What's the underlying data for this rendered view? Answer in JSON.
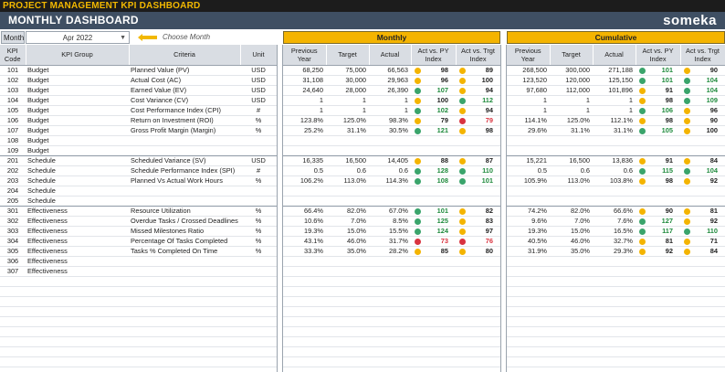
{
  "title_bar": "PROJECT MANAGEMENT KPI DASHBOARD",
  "dashboard_title": "MONTHLY DASHBOARD",
  "brand": "someka",
  "month": {
    "label": "Month",
    "value": "Apr 2022",
    "hint": "Choose Month"
  },
  "groups": {
    "monthly": "Monthly",
    "cumulative": "Cumulative"
  },
  "headers": {
    "kpi_code": "KPI Code",
    "kpi_group": "KPI Group",
    "criteria": "Criteria",
    "unit": "Unit",
    "previous_year": "Previous Year",
    "target": "Target",
    "actual": "Actual",
    "act_vs_py": "Act vs. PY Index",
    "act_vs_trgt": "Act vs. Trgt Index"
  },
  "colors": {
    "yellow": "#f4b400",
    "green": "#3aa46b",
    "red": "#d9333f",
    "header_bar": "#3f4f63"
  },
  "rows": [
    {
      "code": "101",
      "group": "Budget",
      "criteria": "Planned Value (PV)",
      "unit": "USD",
      "m": {
        "py": "68,250",
        "target": "75,000",
        "actual": "66,563",
        "pyi": {
          "dot": "yellow",
          "val": "98",
          "color": "black"
        },
        "tgi": {
          "dot": "yellow",
          "val": "89",
          "color": "black"
        }
      },
      "c": {
        "py": "268,500",
        "target": "300,000",
        "actual": "271,188",
        "pyi": {
          "dot": "green",
          "val": "101",
          "color": "green"
        },
        "tgi": {
          "dot": "yellow",
          "val": "90",
          "color": "black"
        }
      }
    },
    {
      "code": "102",
      "group": "Budget",
      "criteria": "Actual Cost (AC)",
      "unit": "USD",
      "m": {
        "py": "31,108",
        "target": "30,000",
        "actual": "29,963",
        "pyi": {
          "dot": "yellow",
          "val": "96",
          "color": "black"
        },
        "tgi": {
          "dot": "yellow",
          "val": "100",
          "color": "black"
        }
      },
      "c": {
        "py": "123,520",
        "target": "120,000",
        "actual": "125,150",
        "pyi": {
          "dot": "green",
          "val": "101",
          "color": "green"
        },
        "tgi": {
          "dot": "green",
          "val": "104",
          "color": "green"
        }
      }
    },
    {
      "code": "103",
      "group": "Budget",
      "criteria": "Earned Value (EV)",
      "unit": "USD",
      "m": {
        "py": "24,640",
        "target": "28,000",
        "actual": "26,390",
        "pyi": {
          "dot": "green",
          "val": "107",
          "color": "green"
        },
        "tgi": {
          "dot": "yellow",
          "val": "94",
          "color": "black"
        }
      },
      "c": {
        "py": "97,680",
        "target": "112,000",
        "actual": "101,896",
        "pyi": {
          "dot": "yellow",
          "val": "91",
          "color": "black"
        },
        "tgi": {
          "dot": "green",
          "val": "104",
          "color": "green"
        }
      }
    },
    {
      "code": "104",
      "group": "Budget",
      "criteria": "Cost Variance (CV)",
      "unit": "USD",
      "m": {
        "py": "1",
        "target": "1",
        "actual": "1",
        "pyi": {
          "dot": "yellow",
          "val": "100",
          "color": "black"
        },
        "tgi": {
          "dot": "green",
          "val": "112",
          "color": "green"
        }
      },
      "c": {
        "py": "1",
        "target": "1",
        "actual": "1",
        "pyi": {
          "dot": "yellow",
          "val": "98",
          "color": "black"
        },
        "tgi": {
          "dot": "green",
          "val": "109",
          "color": "green"
        }
      }
    },
    {
      "code": "105",
      "group": "Budget",
      "criteria": "Cost Performance Index (CPI)",
      "unit": "#",
      "m": {
        "py": "1",
        "target": "1",
        "actual": "1",
        "pyi": {
          "dot": "green",
          "val": "102",
          "color": "green"
        },
        "tgi": {
          "dot": "yellow",
          "val": "94",
          "color": "black"
        }
      },
      "c": {
        "py": "1",
        "target": "1",
        "actual": "1",
        "pyi": {
          "dot": "green",
          "val": "106",
          "color": "green"
        },
        "tgi": {
          "dot": "yellow",
          "val": "96",
          "color": "black"
        }
      }
    },
    {
      "code": "106",
      "group": "Budget",
      "criteria": "Return on Investment (ROI)",
      "unit": "%",
      "m": {
        "py": "123.8%",
        "target": "125.0%",
        "actual": "98.3%",
        "pyi": {
          "dot": "yellow",
          "val": "79",
          "color": "black"
        },
        "tgi": {
          "dot": "red",
          "val": "79",
          "color": "red"
        }
      },
      "c": {
        "py": "114.1%",
        "target": "125.0%",
        "actual": "112.1%",
        "pyi": {
          "dot": "yellow",
          "val": "98",
          "color": "black"
        },
        "tgi": {
          "dot": "yellow",
          "val": "90",
          "color": "black"
        }
      }
    },
    {
      "code": "107",
      "group": "Budget",
      "criteria": "Gross Profit Margin (Margin)",
      "unit": "%",
      "m": {
        "py": "25.2%",
        "target": "31.1%",
        "actual": "30.5%",
        "pyi": {
          "dot": "green",
          "val": "121",
          "color": "green"
        },
        "tgi": {
          "dot": "yellow",
          "val": "98",
          "color": "black"
        }
      },
      "c": {
        "py": "29.6%",
        "target": "31.1%",
        "actual": "31.1%",
        "pyi": {
          "dot": "green",
          "val": "105",
          "color": "green"
        },
        "tgi": {
          "dot": "yellow",
          "val": "100",
          "color": "black"
        }
      }
    },
    {
      "code": "108",
      "group": "Budget",
      "criteria": "",
      "unit": ""
    },
    {
      "code": "109",
      "group": "Budget",
      "criteria": "",
      "unit": "",
      "sep": true
    },
    {
      "code": "201",
      "group": "Schedule",
      "criteria": "Scheduled Variance (SV)",
      "unit": "USD",
      "m": {
        "py": "16,335",
        "target": "16,500",
        "actual": "14,405",
        "pyi": {
          "dot": "yellow",
          "val": "88",
          "color": "black"
        },
        "tgi": {
          "dot": "yellow",
          "val": "87",
          "color": "black"
        }
      },
      "c": {
        "py": "15,221",
        "target": "16,500",
        "actual": "13,836",
        "pyi": {
          "dot": "yellow",
          "val": "91",
          "color": "black"
        },
        "tgi": {
          "dot": "yellow",
          "val": "84",
          "color": "black"
        }
      }
    },
    {
      "code": "202",
      "group": "Schedule",
      "criteria": "Schedule Performance Index (SPI)",
      "unit": "#",
      "m": {
        "py": "0.5",
        "target": "0.6",
        "actual": "0.6",
        "pyi": {
          "dot": "green",
          "val": "128",
          "color": "green"
        },
        "tgi": {
          "dot": "green",
          "val": "110",
          "color": "green"
        }
      },
      "c": {
        "py": "0.5",
        "target": "0.6",
        "actual": "0.6",
        "pyi": {
          "dot": "green",
          "val": "115",
          "color": "green"
        },
        "tgi": {
          "dot": "green",
          "val": "104",
          "color": "green"
        }
      }
    },
    {
      "code": "203",
      "group": "Schedule",
      "criteria": "Planned Vs Actual Work Hours",
      "unit": "%",
      "m": {
        "py": "106.2%",
        "target": "113.0%",
        "actual": "114.3%",
        "pyi": {
          "dot": "green",
          "val": "108",
          "color": "green"
        },
        "tgi": {
          "dot": "green",
          "val": "101",
          "color": "green"
        }
      },
      "c": {
        "py": "105.9%",
        "target": "113.0%",
        "actual": "103.8%",
        "pyi": {
          "dot": "yellow",
          "val": "98",
          "color": "black"
        },
        "tgi": {
          "dot": "yellow",
          "val": "92",
          "color": "black"
        }
      }
    },
    {
      "code": "204",
      "group": "Schedule",
      "criteria": "",
      "unit": ""
    },
    {
      "code": "205",
      "group": "Schedule",
      "criteria": "",
      "unit": "",
      "sep": true
    },
    {
      "code": "301",
      "group": "Effectiveness",
      "criteria": "Resource Utilization",
      "unit": "%",
      "m": {
        "py": "66.4%",
        "target": "82.0%",
        "actual": "67.0%",
        "pyi": {
          "dot": "green",
          "val": "101",
          "color": "green"
        },
        "tgi": {
          "dot": "yellow",
          "val": "82",
          "color": "black"
        }
      },
      "c": {
        "py": "74.2%",
        "target": "82.0%",
        "actual": "66.6%",
        "pyi": {
          "dot": "yellow",
          "val": "90",
          "color": "black"
        },
        "tgi": {
          "dot": "yellow",
          "val": "81",
          "color": "black"
        }
      }
    },
    {
      "code": "302",
      "group": "Effectiveness",
      "criteria": "Overdue Tasks / Crossed Deadlines",
      "unit": "%",
      "m": {
        "py": "10.6%",
        "target": "7.0%",
        "actual": "8.5%",
        "pyi": {
          "dot": "green",
          "val": "125",
          "color": "green"
        },
        "tgi": {
          "dot": "yellow",
          "val": "83",
          "color": "black"
        }
      },
      "c": {
        "py": "9.6%",
        "target": "7.0%",
        "actual": "7.6%",
        "pyi": {
          "dot": "green",
          "val": "127",
          "color": "green"
        },
        "tgi": {
          "dot": "yellow",
          "val": "92",
          "color": "black"
        }
      }
    },
    {
      "code": "303",
      "group": "Effectiveness",
      "criteria": "Missed Milestones Ratio",
      "unit": "%",
      "m": {
        "py": "19.3%",
        "target": "15.0%",
        "actual": "15.5%",
        "pyi": {
          "dot": "green",
          "val": "124",
          "color": "green"
        },
        "tgi": {
          "dot": "yellow",
          "val": "97",
          "color": "black"
        }
      },
      "c": {
        "py": "19.3%",
        "target": "15.0%",
        "actual": "16.5%",
        "pyi": {
          "dot": "green",
          "val": "117",
          "color": "green"
        },
        "tgi": {
          "dot": "green",
          "val": "110",
          "color": "green"
        }
      }
    },
    {
      "code": "304",
      "group": "Effectiveness",
      "criteria": "Percentage Of Tasks Completed",
      "unit": "%",
      "m": {
        "py": "43.1%",
        "target": "46.0%",
        "actual": "31.7%",
        "pyi": {
          "dot": "red",
          "val": "73",
          "color": "red"
        },
        "tgi": {
          "dot": "red",
          "val": "76",
          "color": "red"
        }
      },
      "c": {
        "py": "40.5%",
        "target": "46.0%",
        "actual": "32.7%",
        "pyi": {
          "dot": "yellow",
          "val": "81",
          "color": "black"
        },
        "tgi": {
          "dot": "yellow",
          "val": "71",
          "color": "black"
        }
      }
    },
    {
      "code": "305",
      "group": "Effectiveness",
      "criteria": "Tasks % Completed On Time",
      "unit": "%",
      "m": {
        "py": "33.3%",
        "target": "35.0%",
        "actual": "28.2%",
        "pyi": {
          "dot": "yellow",
          "val": "85",
          "color": "black"
        },
        "tgi": {
          "dot": "yellow",
          "val": "80",
          "color": "black"
        }
      },
      "c": {
        "py": "31.9%",
        "target": "35.0%",
        "actual": "29.3%",
        "pyi": {
          "dot": "yellow",
          "val": "92",
          "color": "black"
        },
        "tgi": {
          "dot": "yellow",
          "val": "84",
          "color": "black"
        }
      }
    },
    {
      "code": "306",
      "group": "Effectiveness",
      "criteria": "",
      "unit": ""
    },
    {
      "code": "307",
      "group": "Effectiveness",
      "criteria": "",
      "unit": ""
    },
    {
      "code": "",
      "group": "",
      "criteria": "",
      "unit": ""
    },
    {
      "code": "",
      "group": "",
      "criteria": "",
      "unit": ""
    },
    {
      "code": "",
      "group": "",
      "criteria": "",
      "unit": ""
    },
    {
      "code": "",
      "group": "",
      "criteria": "",
      "unit": ""
    },
    {
      "code": "",
      "group": "",
      "criteria": "",
      "unit": ""
    },
    {
      "code": "",
      "group": "",
      "criteria": "",
      "unit": ""
    },
    {
      "code": "",
      "group": "",
      "criteria": "",
      "unit": ""
    },
    {
      "code": "",
      "group": "",
      "criteria": "",
      "unit": ""
    },
    {
      "code": "",
      "group": "",
      "criteria": "",
      "unit": ""
    },
    {
      "code": "",
      "group": "",
      "criteria": "",
      "unit": ""
    }
  ]
}
